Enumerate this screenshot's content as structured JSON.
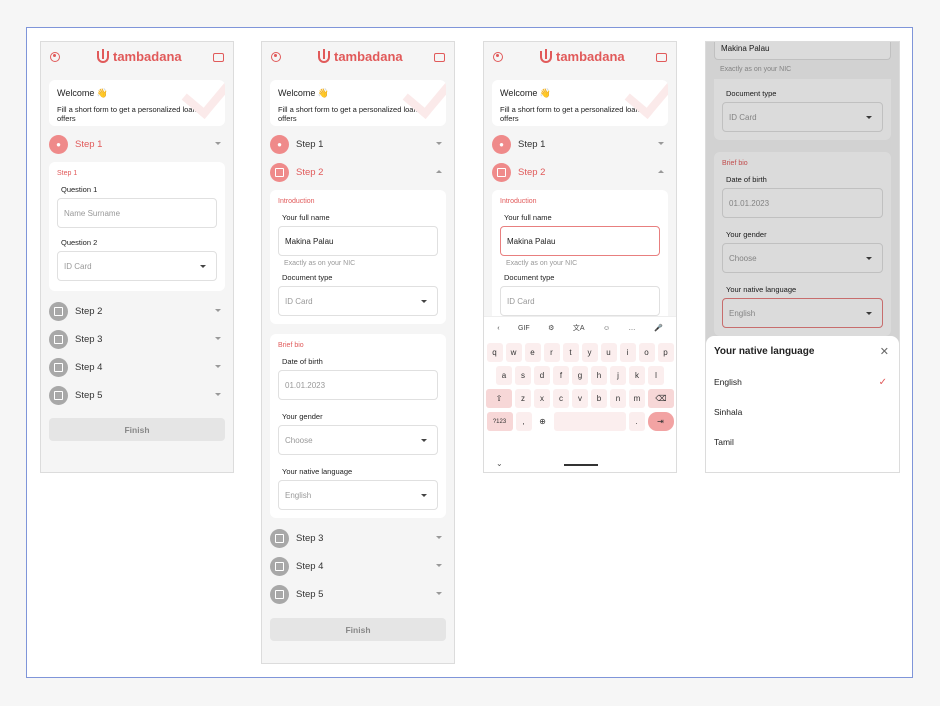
{
  "brand": {
    "name": "tambadana",
    "accent": "#e15a5a"
  },
  "welcome": {
    "title": "Welcome 👋",
    "subtitle": "Fill a short form to get a personalized loan offers"
  },
  "steps": [
    "Step 1",
    "Step 2",
    "Step 3",
    "Step 4",
    "Step 5"
  ],
  "finish_label": "Finish",
  "screen1": {
    "section": "Step 1",
    "q1_label": "Question 1",
    "q1_placeholder": "Name Surname",
    "q2_label": "Question 2",
    "q2_value": "ID Card"
  },
  "intro": {
    "section": "Introduction",
    "name_label": "Your full name",
    "name_value": "Makina Palau",
    "name_hint": "Exactly as on your NIC",
    "doc_label": "Document type",
    "doc_value": "ID Card"
  },
  "bio": {
    "section": "Brief bio",
    "dob_label": "Date of birth",
    "dob_value": "01.01.2023",
    "gender_label": "Your gender",
    "gender_value": "Choose",
    "lang_label": "Your native language",
    "lang_value": "English"
  },
  "keyboard": {
    "toolbar": [
      "‹",
      "GIF",
      "⚙",
      "文A",
      "☺",
      "…",
      "🎤"
    ],
    "row1": [
      "q",
      "w",
      "e",
      "r",
      "t",
      "y",
      "u",
      "i",
      "o",
      "p"
    ],
    "row2": [
      "a",
      "s",
      "d",
      "f",
      "g",
      "h",
      "j",
      "k",
      "l"
    ],
    "row3": [
      "z",
      "x",
      "c",
      "v",
      "b",
      "n",
      "m"
    ],
    "symbols_key": "?123",
    "comma_key": ",",
    "period_key": "."
  },
  "sheet": {
    "title": "Your native language",
    "options": [
      "English",
      "Sinhala",
      "Tamil"
    ],
    "selected": "English"
  }
}
